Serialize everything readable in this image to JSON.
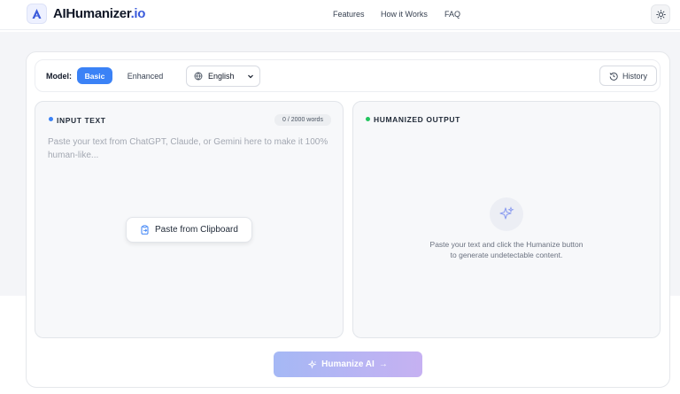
{
  "header": {
    "brand_main": "AIHumanizer",
    "brand_tld": ".io",
    "nav": [
      {
        "label": "Features"
      },
      {
        "label": "How it Works"
      },
      {
        "label": "FAQ"
      }
    ],
    "theme_icon": "sun-icon"
  },
  "toolbar": {
    "model_label": "Model:",
    "modes": [
      {
        "label": "Basic",
        "active": true
      },
      {
        "label": "Enhanced",
        "active": false
      }
    ],
    "language": "English",
    "history_label": "History"
  },
  "input": {
    "title": "INPUT TEXT",
    "word_count": "0 / 2000 words",
    "placeholder": "Paste your text from ChatGPT, Claude, or Gemini here to make it 100% human-like...",
    "paste_label": "Paste from Clipboard",
    "dot_color": "#3b82f6"
  },
  "output": {
    "title": "HUMANIZED OUTPUT",
    "empty_line1": "Paste your text and click the Humanize button",
    "empty_line2": "to generate undetectable content.",
    "dot_color": "#22c55e"
  },
  "action": {
    "humanize_label": "Humanize AI",
    "arrow": "→"
  },
  "colors": {
    "accent": "#3b82f6",
    "brand_tld": "#3b5bdb",
    "button_gradient_start": "#a5b8f5",
    "button_gradient_end": "#c6b1f2"
  }
}
